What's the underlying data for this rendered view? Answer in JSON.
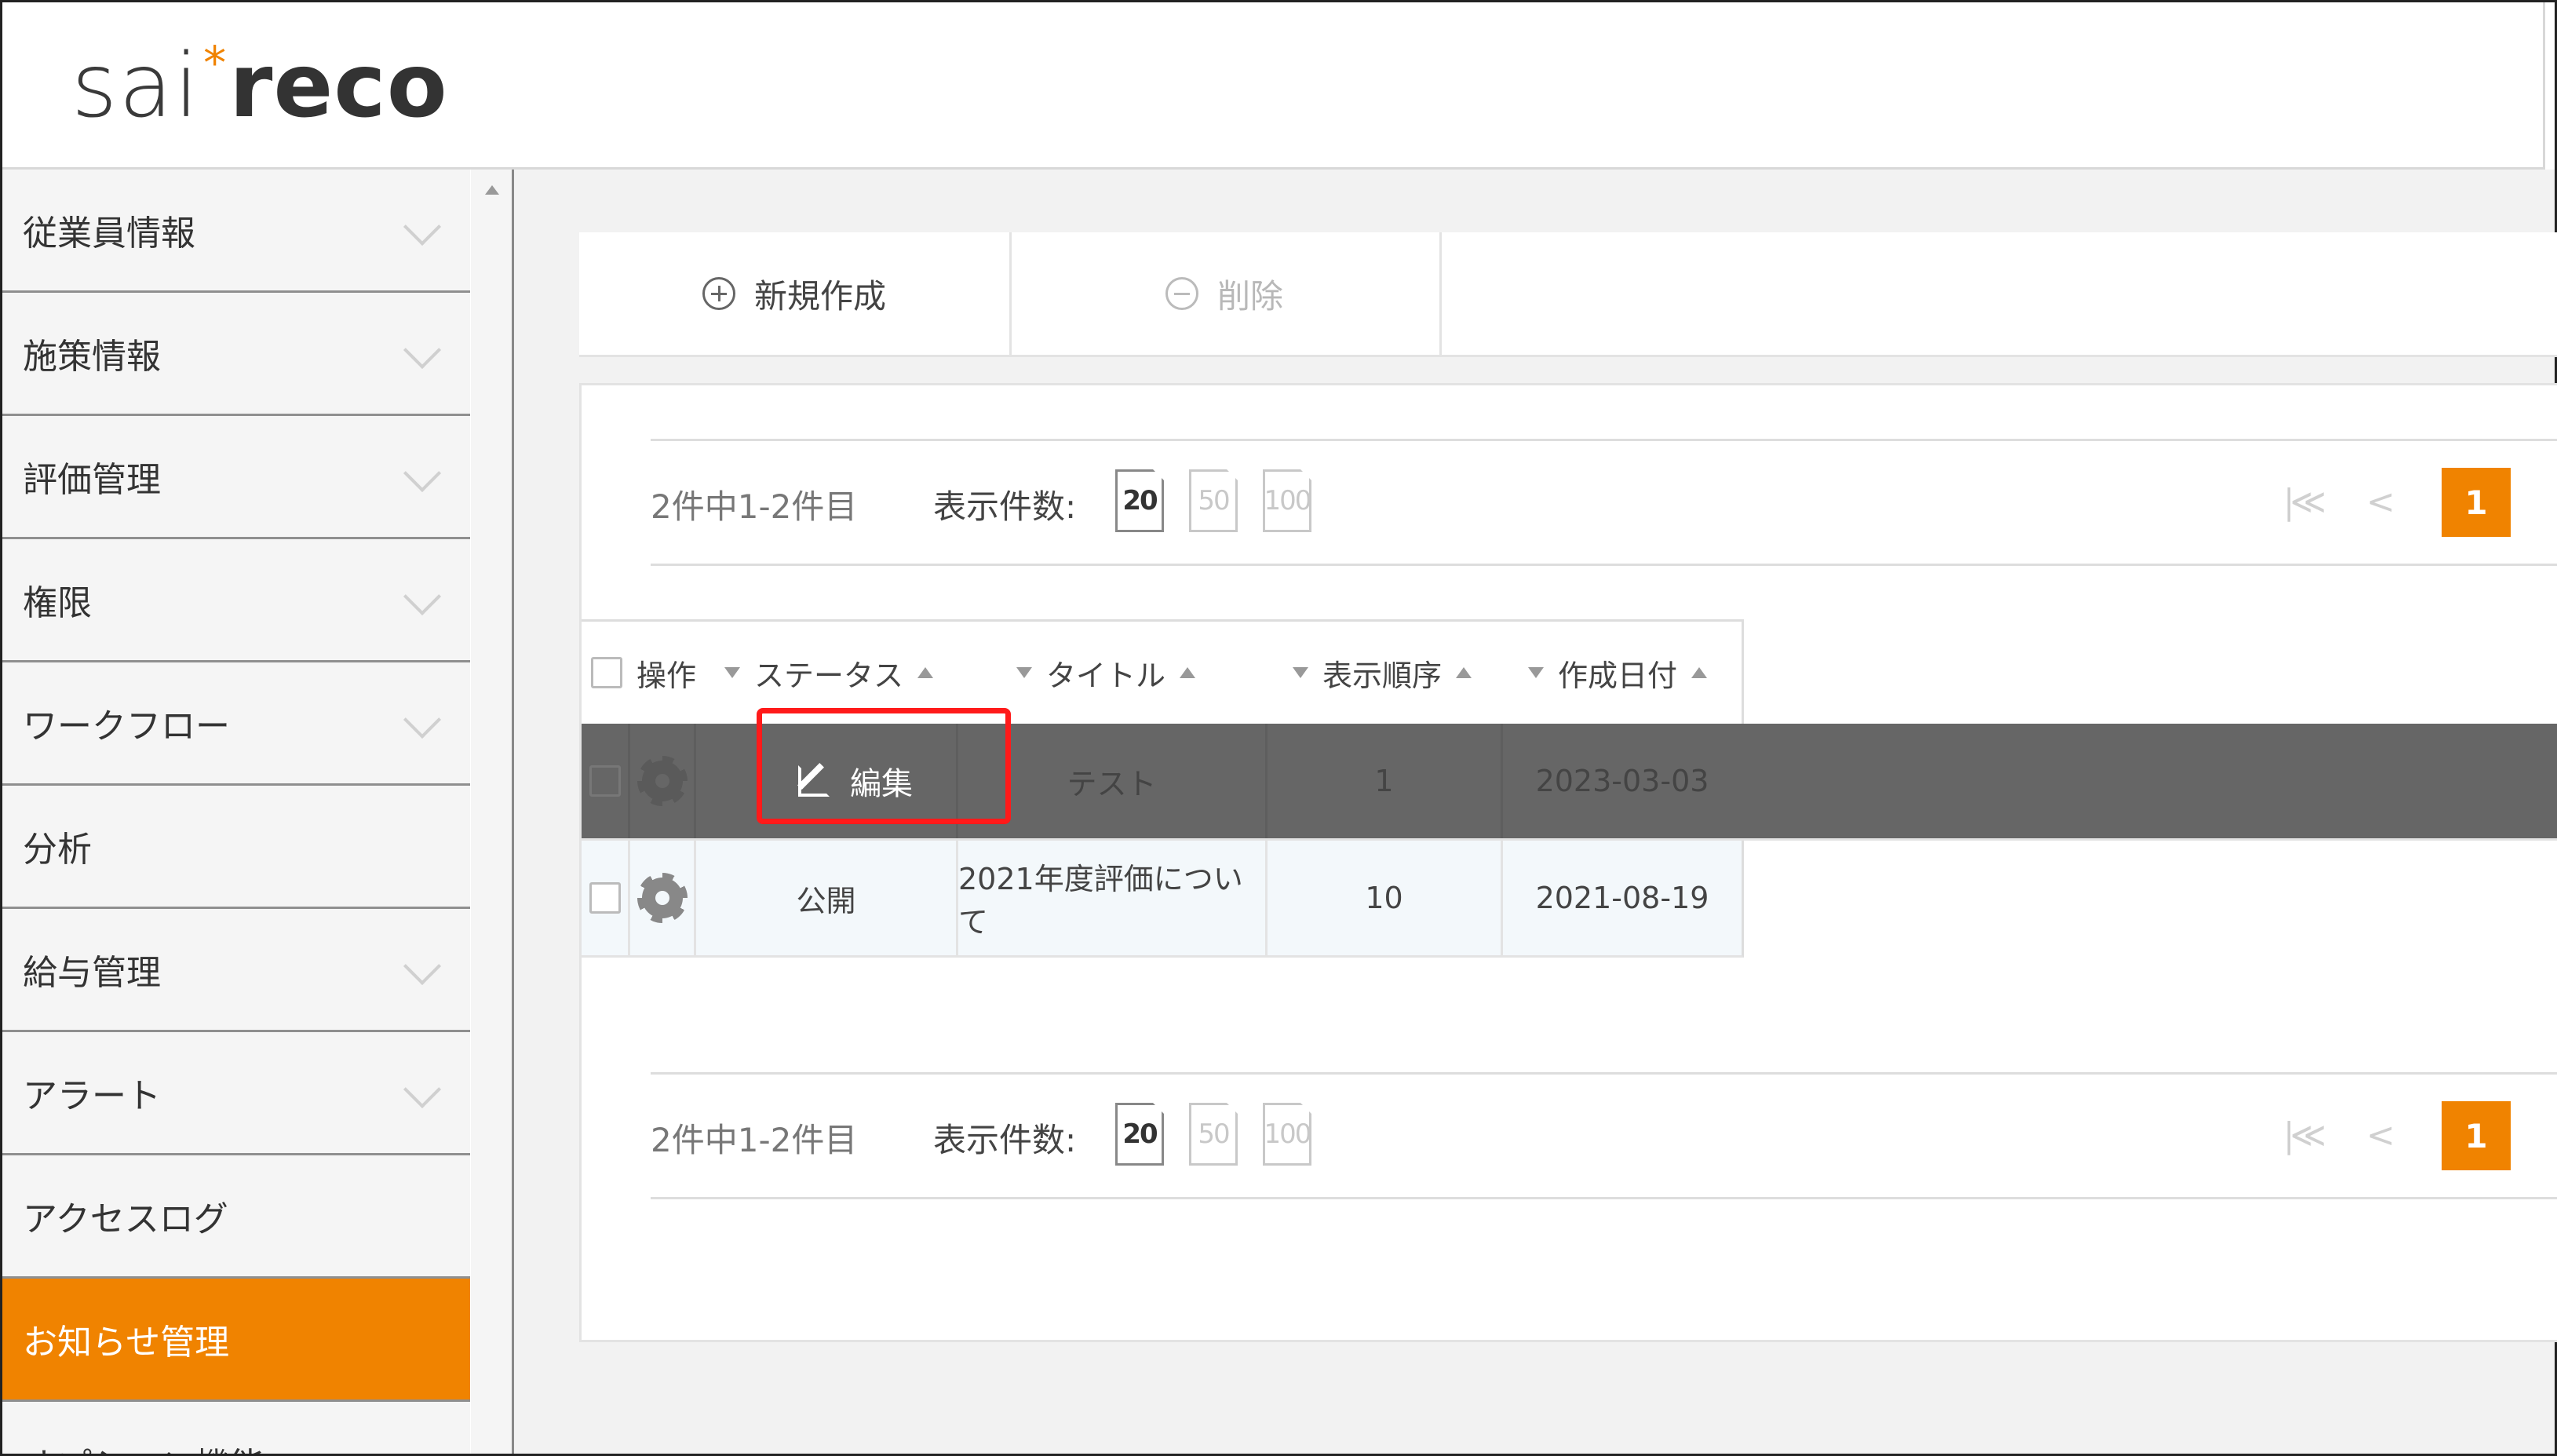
{
  "logo": {
    "part1": "sai",
    "star": "*",
    "part2": "reco"
  },
  "sidebar": {
    "items": [
      {
        "label": "従業員情報",
        "expandable": true
      },
      {
        "label": "施策情報",
        "expandable": true
      },
      {
        "label": "評価管理",
        "expandable": true
      },
      {
        "label": "権限",
        "expandable": true
      },
      {
        "label": "ワークフロー",
        "expandable": true
      },
      {
        "label": "分析",
        "expandable": false
      },
      {
        "label": "給与管理",
        "expandable": true
      },
      {
        "label": "アラート",
        "expandable": true
      },
      {
        "label": "アクセスログ",
        "expandable": false
      },
      {
        "label": "お知らせ管理",
        "expandable": false,
        "active": true
      },
      {
        "label": "オプション機能",
        "expandable": false
      }
    ]
  },
  "toolbar": {
    "new_label": "新規作成",
    "delete_label": "削除"
  },
  "pager": {
    "count_text": "2件中1-2件目",
    "per_page_label": "表示件数:",
    "per_page_options": [
      "20",
      "50",
      "100"
    ],
    "per_page_selected": "20",
    "first_symbol": "|≪",
    "prev_symbol": "<",
    "current_page": "1"
  },
  "table": {
    "headers": {
      "action": "操作",
      "status": "ステータス",
      "title": "タイトル",
      "order": "表示順序",
      "created": "作成日付"
    },
    "rows": [
      {
        "status": "",
        "title": "テスト",
        "order": "1",
        "created": "2023-03-03"
      },
      {
        "status": "公開",
        "title": "2021年度評価について",
        "order": "10",
        "created": "2021-08-19"
      }
    ],
    "edit_label": "編集"
  },
  "colors": {
    "accent": "#f08300",
    "hover_row": "#666666",
    "highlight": "#ff1a1a"
  }
}
